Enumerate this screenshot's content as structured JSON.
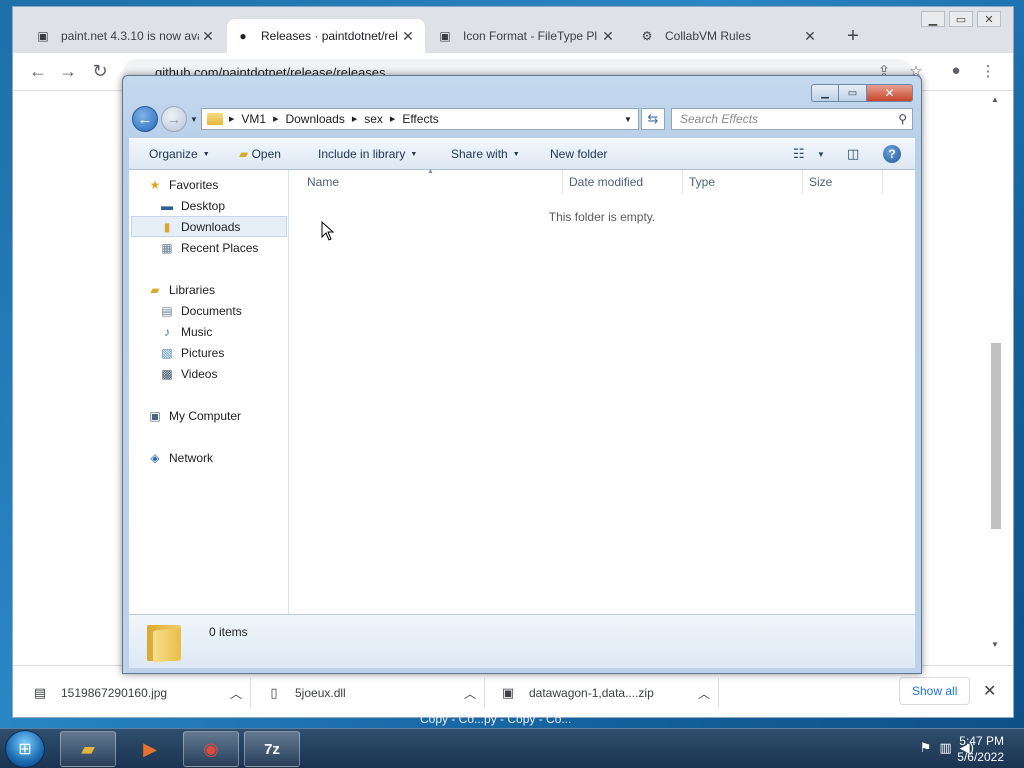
{
  "browser": {
    "tabs": [
      {
        "title": "paint.net 4.3.10 is now ava",
        "icon": "paintnet-icon"
      },
      {
        "title": "Releases · paintdotnet/rel",
        "icon": "github-icon"
      },
      {
        "title": "Icon Format - FileType Pl",
        "icon": "paintnet-icon"
      },
      {
        "title": "CollabVM Rules",
        "icon": "collabvm-icon"
      }
    ],
    "url": "github.com/paintdotnet/release/releases",
    "downloads": [
      {
        "name": "1519867290160.jpg"
      },
      {
        "name": "5joeux.dll"
      },
      {
        "name": "datawagon-1,data....zip"
      }
    ],
    "show_all": "Show all"
  },
  "explorer": {
    "breadcrumb": [
      "VM1",
      "Downloads",
      "sex",
      "Effects"
    ],
    "search_placeholder": "Search Effects",
    "commands": {
      "organize": "Organize",
      "open": "Open",
      "include": "Include in library",
      "share": "Share with",
      "new_folder": "New folder"
    },
    "nav": {
      "favorites": "Favorites",
      "desktop": "Desktop",
      "downloads": "Downloads",
      "recent": "Recent Places",
      "libraries": "Libraries",
      "documents": "Documents",
      "music": "Music",
      "pictures": "Pictures",
      "videos": "Videos",
      "computer": "My Computer",
      "network": "Network"
    },
    "columns": {
      "name": "Name",
      "date": "Date modified",
      "type": "Type",
      "size": "Size"
    },
    "empty_message": "This folder is empty.",
    "item_count": "0 items"
  },
  "taskbar": {
    "ghost_text": "Copy - Co...py - Copy - Co...",
    "time": "5:47 PM",
    "date": "5/6/2022"
  }
}
